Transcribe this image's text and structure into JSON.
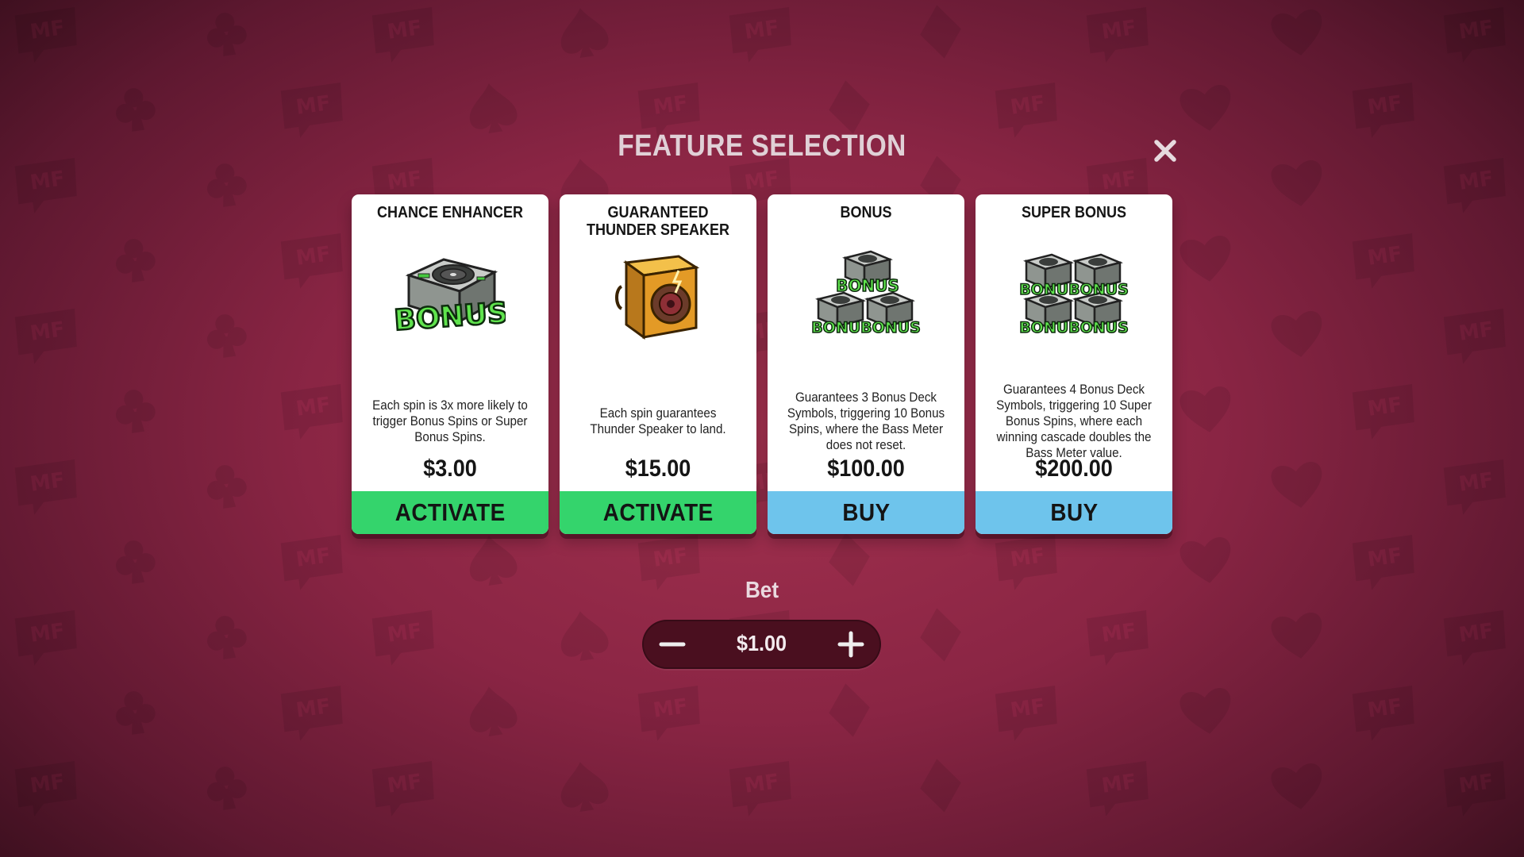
{
  "modal": {
    "title": "FEATURE SELECTION",
    "close_icon": "close-icon"
  },
  "background": {
    "logo_text": "MF",
    "suits": [
      "club",
      "spade",
      "diamond",
      "heart"
    ]
  },
  "colors": {
    "activate": "#34d46c",
    "buy": "#6ec4ec",
    "background": "#8a2544"
  },
  "features": [
    {
      "title": "CHANCE ENHANCER",
      "icon": "bonus-turntable-icon",
      "badge_text": "BONUS",
      "description": "Each spin is 3x more likely to trigger Bonus Spins or Super Bonus Spins.",
      "price": "$3.00",
      "button_label": "ACTIVATE"
    },
    {
      "title": "GUARANTEED THUNDER SPEAKER",
      "icon": "thunder-speaker-icon",
      "description": "Each spin guarantees Thunder Speaker to land.",
      "price": "$15.00",
      "button_label": "ACTIVATE"
    },
    {
      "title": "BONUS",
      "icon": "three-bonus-decks-icon",
      "badge_text": "BONUS",
      "badge_text_2": "BONUBONUS",
      "description": "Guarantees 3 Bonus Deck Symbols, triggering 10 Bonus Spins, where the Bass Meter does not reset.",
      "price": "$100.00",
      "button_label": "BUY"
    },
    {
      "title": "SUPER BONUS",
      "icon": "four-bonus-decks-icon",
      "badge_text": "BONUBONUS",
      "description": "Guarantees 4 Bonus Deck Symbols, triggering 10 Super Bonus Spins, where each winning cascade doubles the Bass Meter value.",
      "price": "$200.00",
      "button_label": "BUY"
    }
  ],
  "bet": {
    "label": "Bet",
    "value": "$1.00",
    "decrease_icon": "minus-icon",
    "increase_icon": "plus-icon"
  }
}
